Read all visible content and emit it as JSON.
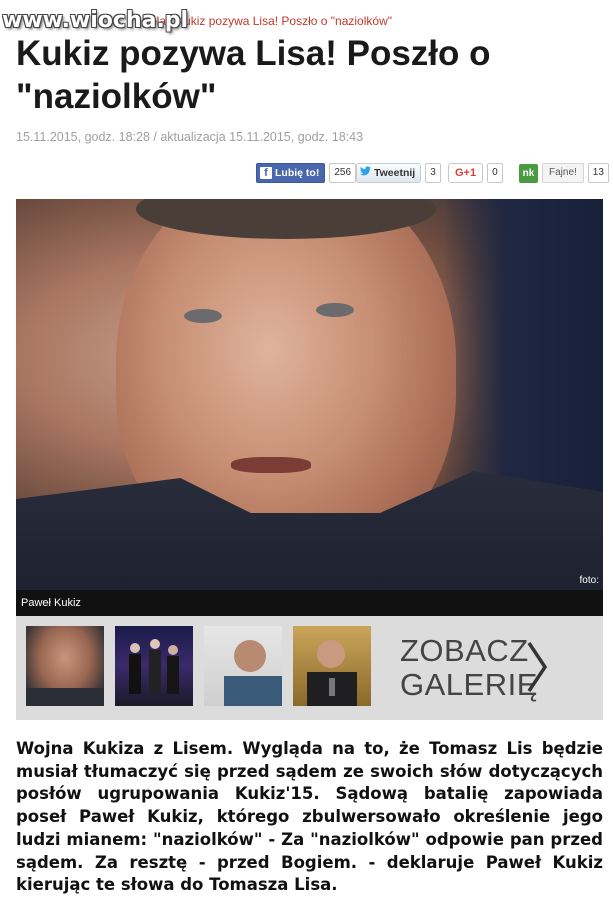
{
  "watermark": "www.wiocha.pl",
  "breadcrumb": {
    "part1": "a",
    "part2": "pla",
    "separator": "/",
    "current": "Kukiz pozywa Lisa! Poszło o \"naziolków\""
  },
  "article": {
    "title": "Kukiz pozywa Lisa! Poszło o \"naziolków\"",
    "meta": "15.11.2015, godz. 18:28 / aktualizacja 15.11.2015, godz. 18:43",
    "body": "Wojna Kukiza z Lisem. Wygląda na to, że Tomasz Lis będzie musiał tłumaczyć się przed sądem ze swoich słów dotyczących posłów ugrupowania Kukiz'15. Sądową batalię zapowiada poseł Paweł Kukiz, którego zbulwersowało określenie jego ludzi mianem: \"naziolków\" - Za \"naziolków\" odpowie pan przed sądem. Za resztę - przed Bogiem. - deklaruje Paweł Kukiz kierując te słowa do Tomasza Lisa."
  },
  "social": {
    "facebook": {
      "label": "Lubię to!",
      "count": "256",
      "icon": "facebook-icon"
    },
    "twitter": {
      "label": "Tweetnij",
      "count": "3",
      "icon": "twitter-bird-icon"
    },
    "gplus": {
      "label": "G+1",
      "count": "0"
    },
    "nk": {
      "logo": "nk",
      "label": "Fajne!",
      "count": "13"
    }
  },
  "photo": {
    "caption": "Paweł Kukiz",
    "credit": "foto:"
  },
  "gallery": {
    "cta_line1": "ZOBACZ",
    "cta_line2": "GALERIĘ",
    "arrow_icon": "chevron-right-icon"
  },
  "colors": {
    "facebook": "#4a67ad",
    "twitter_bird": "#2aa3ef",
    "gplus": "#d73d32",
    "nk": "#4a9a3f",
    "breadcrumb_link": "#c0392b",
    "meta_text": "#a0a0a0",
    "gallery_bg": "#dcdcdc",
    "caption_bg": "#111111"
  }
}
